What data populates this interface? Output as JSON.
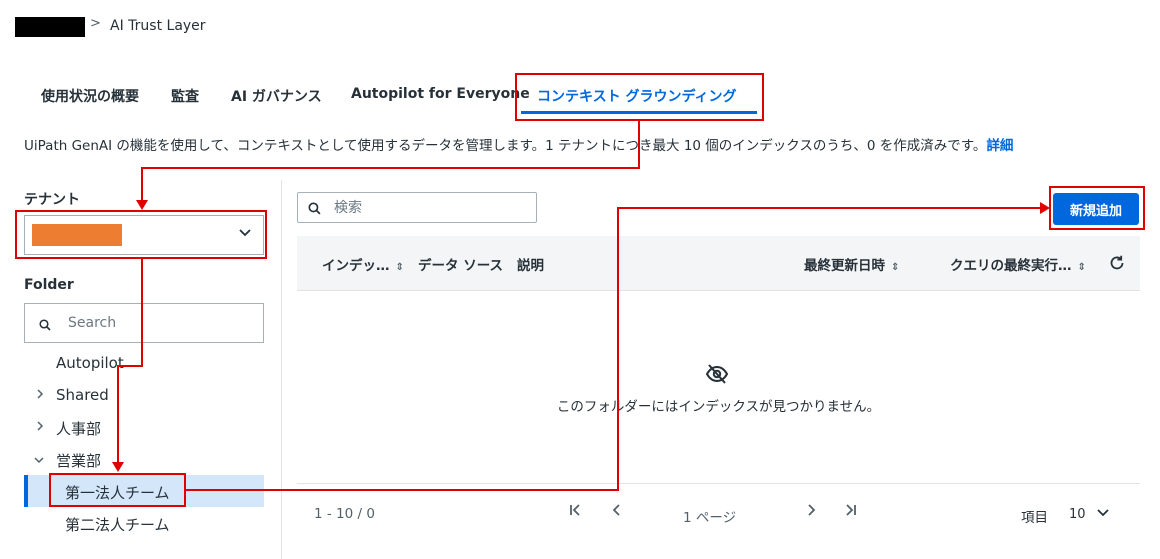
{
  "breadcrumb": {
    "separator": ">",
    "current": "AI Trust Layer"
  },
  "tabs": [
    {
      "label": "使用状況の概要"
    },
    {
      "label": "監査"
    },
    {
      "label": "AI ガバナンス"
    },
    {
      "label": "Autopilot for Everyone"
    },
    {
      "label": "コンテキスト グラウンディング",
      "active": true
    }
  ],
  "description": {
    "text": "UiPath GenAI の機能を使用して、コンテキストとして使用するデータを管理します。1 テナントにつき最大 10 個のインデックスのうち、0 を作成済みです。",
    "link": "詳細"
  },
  "tenant": {
    "label": "テナント",
    "selected": ""
  },
  "folder": {
    "label": "Folder",
    "search_placeholder": "Search",
    "tree": [
      {
        "label": "Autopilot",
        "expandable": false
      },
      {
        "label": "Shared",
        "expandable": true,
        "expanded": false
      },
      {
        "label": "人事部",
        "expandable": true,
        "expanded": false
      },
      {
        "label": "営業部",
        "expandable": true,
        "expanded": true
      },
      {
        "label": "第一法人チーム",
        "selected": true
      },
      {
        "label": "第二法人チーム"
      }
    ]
  },
  "search": {
    "placeholder": "検索"
  },
  "add_button": {
    "label": "新規追加"
  },
  "table": {
    "columns": [
      {
        "label": "インデッ…"
      },
      {
        "label": "データ ソース"
      },
      {
        "label": "説明"
      },
      {
        "label": "最終更新日時"
      },
      {
        "label": "クエリの最終実行…"
      }
    ],
    "empty_message": "このフォルダーにはインデックスが見つかりません。"
  },
  "pagination": {
    "range": "1 - 10 / 0",
    "page_label": "1 ページ",
    "items_label": "項目",
    "items_per_page": "10"
  },
  "colors": {
    "accent": "#0067df",
    "annotation": "#e00000",
    "redaction_orange": "#ed7d31"
  }
}
